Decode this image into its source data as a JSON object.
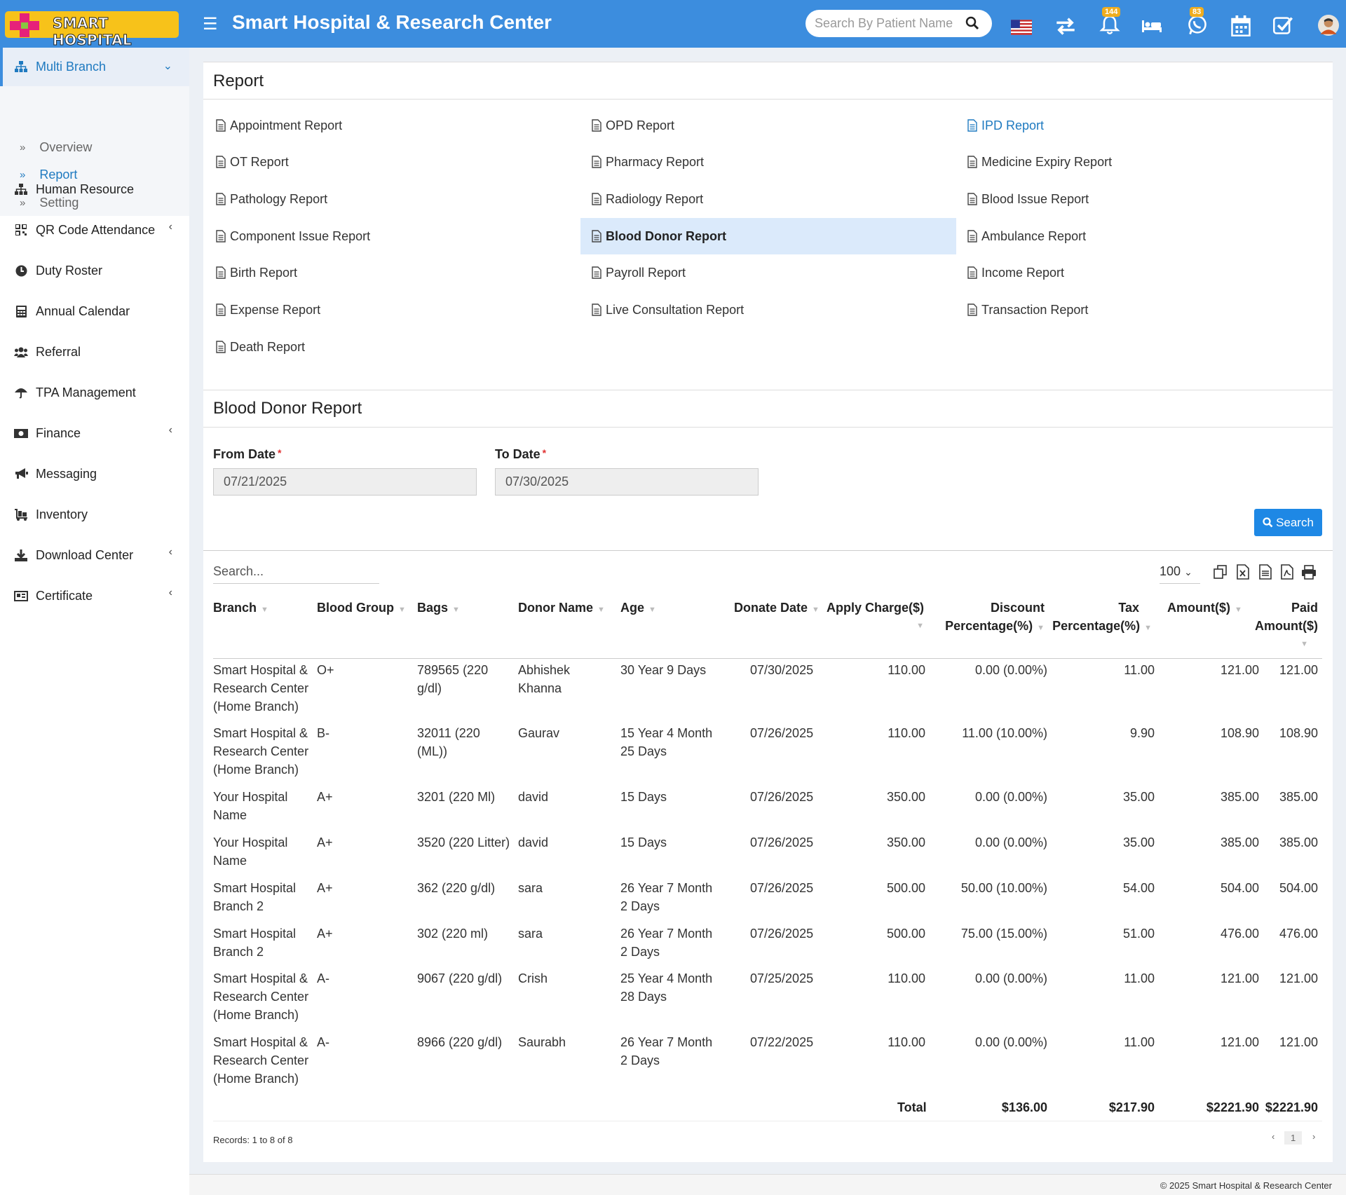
{
  "header": {
    "logo_text": "SMART HOSPITAL",
    "title": "Smart Hospital & Research Center",
    "search_placeholder": "Search By Patient Name",
    "notification_count": "144",
    "whatsapp_count": "83"
  },
  "sidebar": {
    "multi_branch": "Multi Branch",
    "sub": [
      {
        "label": "Overview"
      },
      {
        "label": "Report"
      },
      {
        "label": "Setting"
      }
    ],
    "items": [
      {
        "label": "Human Resource"
      },
      {
        "label": "QR Code Attendance"
      },
      {
        "label": "Duty Roster"
      },
      {
        "label": "Annual Calendar"
      },
      {
        "label": "Referral"
      },
      {
        "label": "TPA Management"
      },
      {
        "label": "Finance"
      },
      {
        "label": "Messaging"
      },
      {
        "label": "Inventory"
      },
      {
        "label": "Download Center"
      },
      {
        "label": "Certificate"
      }
    ]
  },
  "report": {
    "title": "Report",
    "links": [
      "Appointment Report",
      "OPD Report",
      "IPD Report",
      "OT Report",
      "Pharmacy Report",
      "Medicine Expiry Report",
      "Pathology Report",
      "Radiology Report",
      "Blood Issue Report",
      "Component Issue Report",
      "Blood Donor Report",
      "Ambulance Report",
      "Birth Report",
      "Payroll Report",
      "Income Report",
      "Expense Report",
      "Live Consultation Report",
      "Transaction Report",
      "Death Report"
    ]
  },
  "donor": {
    "title": "Blood Donor Report",
    "from_label": "From Date",
    "to_label": "To Date",
    "required_mark": "*",
    "from_value": "07/21/2025",
    "to_value": "07/30/2025",
    "search_button": "Search"
  },
  "table": {
    "search_placeholder": "Search...",
    "page_size": "100",
    "headers": {
      "branch": "Branch",
      "blood_group": "Blood Group",
      "bags": "Bags",
      "donor_name": "Donor Name",
      "age": "Age",
      "donate_date": "Donate Date",
      "apply_charge": "Apply Charge($)",
      "discount_1": "Discount",
      "discount_2": "Percentage(%)",
      "tax_1": "Tax",
      "tax_2": "Percentage(%)",
      "amount": "Amount($)",
      "paid_1": "Paid",
      "paid_2": "Amount($)"
    },
    "rows": [
      {
        "branch": [
          "Smart Hospital &",
          "Research Center",
          "(Home Branch)"
        ],
        "group": "O+",
        "bags": [
          "789565 (220",
          "g/dl)"
        ],
        "donor": [
          "Abhishek",
          "Khanna"
        ],
        "age": [
          "30 Year 9 Days"
        ],
        "date": "07/30/2025",
        "charge": "110.00",
        "discount": "0.00 (0.00%)",
        "tax": "11.00",
        "amount": "121.00",
        "paid": "121.00"
      },
      {
        "branch": [
          "Smart Hospital &",
          "Research Center",
          "(Home Branch)"
        ],
        "group": "B-",
        "bags": [
          "32011 (220",
          "(ML))"
        ],
        "donor": [
          "Gaurav"
        ],
        "age": [
          "15 Year 4 Month",
          "25 Days"
        ],
        "date": "07/26/2025",
        "charge": "110.00",
        "discount": "11.00 (10.00%)",
        "tax": "9.90",
        "amount": "108.90",
        "paid": "108.90"
      },
      {
        "branch": [
          "Your Hospital",
          "Name"
        ],
        "group": "A+",
        "bags": [
          "3201 (220 Ml)"
        ],
        "donor": [
          "david"
        ],
        "age": [
          "15 Days"
        ],
        "date": "07/26/2025",
        "charge": "350.00",
        "discount": "0.00 (0.00%)",
        "tax": "35.00",
        "amount": "385.00",
        "paid": "385.00"
      },
      {
        "branch": [
          "Your Hospital",
          "Name"
        ],
        "group": "A+",
        "bags": [
          "3520 (220 Litter)"
        ],
        "donor": [
          "david"
        ],
        "age": [
          "15 Days"
        ],
        "date": "07/26/2025",
        "charge": "350.00",
        "discount": "0.00 (0.00%)",
        "tax": "35.00",
        "amount": "385.00",
        "paid": "385.00"
      },
      {
        "branch": [
          "Smart Hospital",
          "Branch 2"
        ],
        "group": "A+",
        "bags": [
          "362 (220 g/dl)"
        ],
        "donor": [
          "sara"
        ],
        "age": [
          "26 Year 7 Month",
          "2 Days"
        ],
        "date": "07/26/2025",
        "charge": "500.00",
        "discount": "50.00 (10.00%)",
        "tax": "54.00",
        "amount": "504.00",
        "paid": "504.00"
      },
      {
        "branch": [
          "Smart Hospital",
          "Branch 2"
        ],
        "group": "A+",
        "bags": [
          "302 (220 ml)"
        ],
        "donor": [
          "sara"
        ],
        "age": [
          "26 Year 7 Month",
          "2 Days"
        ],
        "date": "07/26/2025",
        "charge": "500.00",
        "discount": "75.00 (15.00%)",
        "tax": "51.00",
        "amount": "476.00",
        "paid": "476.00"
      },
      {
        "branch": [
          "Smart Hospital &",
          "Research Center",
          "(Home Branch)"
        ],
        "group": "A-",
        "bags": [
          "9067 (220 g/dl)"
        ],
        "donor": [
          "Crish"
        ],
        "age": [
          "25 Year 4 Month",
          "28 Days"
        ],
        "date": "07/25/2025",
        "charge": "110.00",
        "discount": "0.00 (0.00%)",
        "tax": "11.00",
        "amount": "121.00",
        "paid": "121.00"
      },
      {
        "branch": [
          "Smart Hospital &",
          "Research Center",
          "(Home Branch)"
        ],
        "group": "A-",
        "bags": [
          "8966 (220 g/dl)"
        ],
        "donor": [
          "Saurabh"
        ],
        "age": [
          "26 Year 7 Month",
          "2 Days"
        ],
        "date": "07/22/2025",
        "charge": "110.00",
        "discount": "0.00 (0.00%)",
        "tax": "11.00",
        "amount": "121.00",
        "paid": "121.00"
      }
    ],
    "totals": {
      "label": "Total",
      "discount": "$136.00",
      "tax": "$217.90",
      "amount": "$2221.90",
      "paid": "$2221.90"
    },
    "records": "Records: 1 to 8 of 8",
    "page": "1"
  },
  "footer": "© 2025 Smart Hospital & Research Center"
}
